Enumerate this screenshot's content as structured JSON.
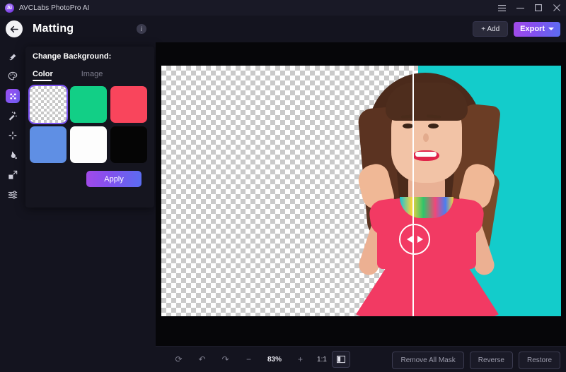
{
  "titlebar": {
    "app_name": "AVCLabs PhotoPro AI",
    "logo_icon": "app-logo-icon",
    "controls": [
      {
        "name": "menu-icon",
        "label": "☰"
      },
      {
        "name": "minimize-icon",
        "label": "—"
      },
      {
        "name": "maximize-icon",
        "label": "□"
      },
      {
        "name": "close-icon",
        "label": "✕"
      }
    ]
  },
  "header": {
    "back_icon": "←",
    "title": "Matting",
    "info_icon": "i",
    "add_label": "+ Add",
    "export_label": "Export"
  },
  "sidebar": {
    "items": [
      {
        "label": "Inpaint",
        "icon": "inpaint-icon",
        "active": false
      },
      {
        "label": "Recolor",
        "icon": "recolor-icon",
        "active": false
      },
      {
        "label": "Matting",
        "icon": "matting-icon",
        "active": true
      },
      {
        "label": "Enhance",
        "icon": "enhance-icon",
        "active": false
      },
      {
        "label": "Stylize",
        "icon": "stylize-icon",
        "active": false
      },
      {
        "label": "Colorize",
        "icon": "colorize-icon",
        "active": false
      },
      {
        "label": "Upscale",
        "icon": "upscale-icon",
        "active": false
      },
      {
        "label": "Toning",
        "icon": "toning-icon",
        "active": false
      }
    ]
  },
  "panel": {
    "title": "Change Background:",
    "tabs": [
      {
        "label": "Color",
        "selected": true
      },
      {
        "label": "Image",
        "selected": false
      }
    ],
    "swatches": [
      {
        "name": "swatch-transparent",
        "color": "transparent",
        "selected": true
      },
      {
        "name": "swatch-green",
        "color": "#12cf86",
        "selected": false
      },
      {
        "name": "swatch-red",
        "color": "#f9455c",
        "selected": false
      },
      {
        "name": "swatch-blue",
        "color": "#5f8fe4",
        "selected": false
      },
      {
        "name": "swatch-white",
        "color": "#fdfdfd",
        "selected": false
      },
      {
        "name": "swatch-black",
        "color": "#050505",
        "selected": false
      }
    ],
    "apply_label": "Apply"
  },
  "canvas": {
    "background_color": "#13cccb",
    "divider_label": "compare-slider"
  },
  "bottombar": {
    "tools": [
      {
        "name": "reset-button",
        "label": "⟳"
      },
      {
        "name": "undo-button",
        "label": "↶"
      },
      {
        "name": "redo-button",
        "label": "↷"
      },
      {
        "name": "zoom-out-button",
        "label": "−"
      },
      {
        "name": "zoom-level",
        "label": "83%"
      },
      {
        "name": "zoom-in-button",
        "label": "+"
      },
      {
        "name": "actual-size-button",
        "label": "1:1"
      },
      {
        "name": "compare-view-button",
        "label": "⬚"
      }
    ],
    "actions": [
      {
        "name": "remove-all-mask-button",
        "label": "Remove All Mask"
      },
      {
        "name": "reverse-button",
        "label": "Reverse"
      },
      {
        "name": "restore-button",
        "label": "Restore"
      }
    ]
  }
}
